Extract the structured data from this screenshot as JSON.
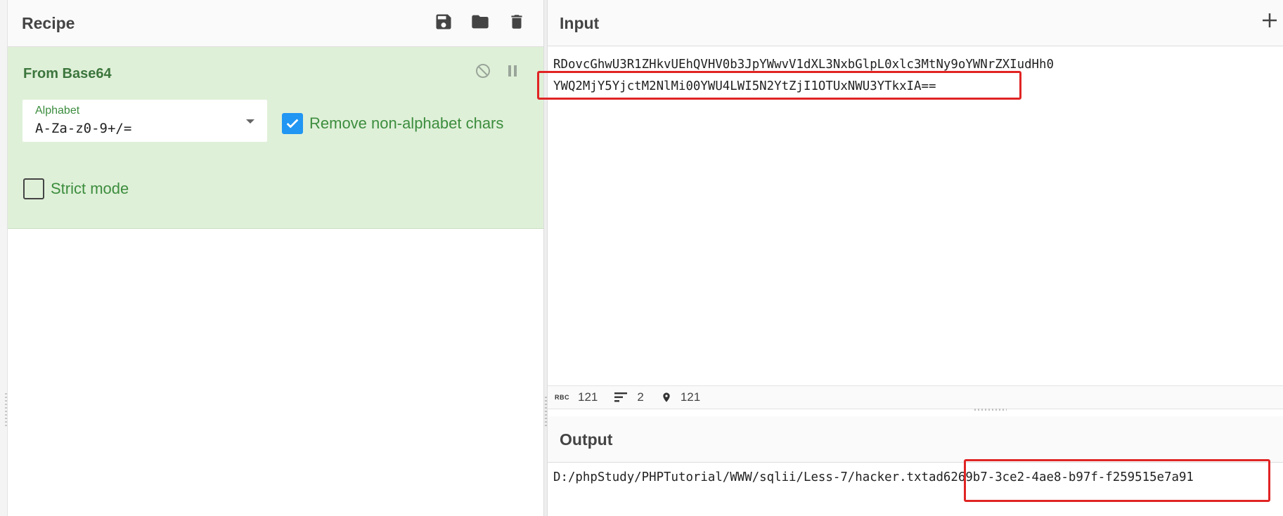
{
  "recipe": {
    "title": "Recipe",
    "icons": [
      "save-icon",
      "folder-icon",
      "trash-icon"
    ],
    "operation": {
      "name": "From Base64",
      "alphabet_label": "Alphabet",
      "alphabet_value": "A-Za-z0-9+/=",
      "remove_non_alphabet_label": "Remove non-alphabet chars",
      "remove_non_alphabet_checked": true,
      "strict_mode_label": "Strict mode",
      "strict_mode_checked": false
    }
  },
  "input": {
    "title": "Input",
    "line1": "RDovcGhwU3R1ZHkvUEhQVHV0b3JpYWwvV1dXL3NxbGlpL0xlc3MtNy9oYWNrZXIudHh0",
    "line2": "YWQ2MjY5YjctM2NlMi00YWU4LWI5N2YtZjI1OTUxNWU3YTkxIA==",
    "stats": {
      "chars_icon": "RBC",
      "chars": "121",
      "lines": "2",
      "position": "121"
    }
  },
  "output": {
    "title": "Output",
    "text": "D:/phpStudy/PHPTutorial/WWW/sqlii/Less-7/hacker.txtad6269b7-3ce2-4ae8-b97f-f259515e7a91"
  },
  "colors": {
    "accent_green": "#3c763d",
    "operation_bg": "#dff0d8",
    "checkbox_blue": "#2196f3",
    "highlight_red": "#e02424"
  }
}
